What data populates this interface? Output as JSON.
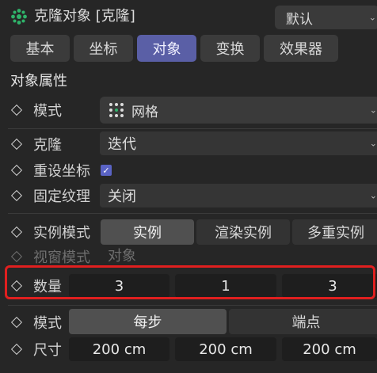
{
  "header": {
    "title": "克隆对象 [克隆]",
    "preset_value": "默认"
  },
  "tabs": [
    {
      "label": "基本",
      "active": false
    },
    {
      "label": "坐标",
      "active": false
    },
    {
      "label": "对象",
      "active": true
    },
    {
      "label": "变换",
      "active": false
    },
    {
      "label": "效果器",
      "active": false
    }
  ],
  "section_title": "对象属性",
  "props": {
    "mode_label": "模式",
    "mode_value": "网格",
    "clone_label": "克隆",
    "clone_value": "迭代",
    "reset_coords_label": "重设坐标",
    "reset_coords_checked": true,
    "fixed_texture_label": "固定纹理",
    "fixed_texture_value": "关闭",
    "instance_mode_label": "实例模式",
    "instance_mode_options": [
      "实例",
      "渲染实例",
      "多重实例"
    ],
    "instance_mode_selected": "实例",
    "viewport_mode_label": "视窗模式",
    "viewport_mode_value": "对象",
    "count_label": "数量",
    "count_values": [
      "3",
      "1",
      "3"
    ],
    "grid_mode_label": "模式",
    "grid_mode_options": [
      "每步",
      "端点"
    ],
    "grid_mode_selected": "每步",
    "size_label": "尺寸",
    "size_values": [
      "200 cm",
      "200 cm",
      "200 cm"
    ]
  },
  "colors": {
    "active_tab": "#5a5fa6",
    "highlight_border": "#e01f1f",
    "checkbox": "#5a63c4"
  }
}
